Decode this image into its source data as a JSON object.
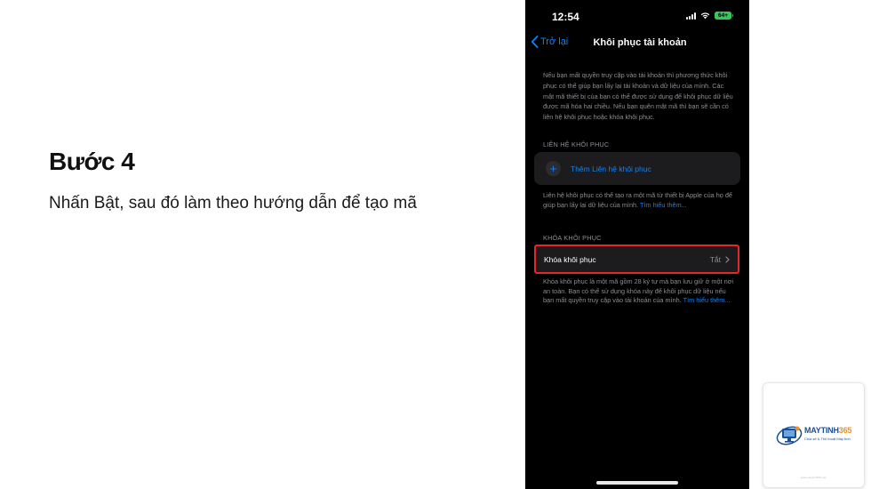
{
  "slide": {
    "title": "Bước 4",
    "description": "Nhấn Bật, sau đó làm theo hướng dẫn để tạo mã"
  },
  "status_bar": {
    "time": "12:54",
    "battery": "64+"
  },
  "nav": {
    "back_label": "Trở lại",
    "title": "Khôi phục tài khoản"
  },
  "intro_text": "Nếu bạn mất quyền truy cập vào tài khoản thì phương thức khôi phục có thể giúp bạn lấy lại tài khoản và dữ liệu của mình. Các mật mã thiết bị của bạn có thể được sử dụng để khôi phục dữ liệu được mã hóa hai chiều. Nếu bạn quên mật mã thì bạn sẽ cần có liên hệ khôi phục hoặc khóa khôi phục.",
  "recovery_contact": {
    "header": "LIÊN HỆ KHÔI PHỤC",
    "add_label": "Thêm Liên hệ khôi phục",
    "footer": "Liên hệ khôi phục có thể tạo ra một mã từ thiết bị Apple của họ để giúp bạn lấy lại dữ liệu của mình.",
    "footer_link": "Tìm hiểu thêm..."
  },
  "recovery_key": {
    "header": "KHÓA KHÔI PHỤC",
    "label": "Khóa khôi phục",
    "value": "Tắt",
    "footer": "Khóa khôi phục là một mã gồm 28 ký tự mà bạn lưu giữ ở một nơi an toàn. Bạn có thể sử dụng khóa này để khôi phục dữ liệu nếu bạn mất quyền truy cập vào tài khoản của mình.",
    "footer_link": "Tìm hiểu thêm..."
  },
  "logo": {
    "brand_part1": "MAYTINH",
    "brand_part2": "365",
    "tagline": "Chia sẻ & Thủ thuật Máy tính",
    "url": "www.maytinh365.com"
  },
  "colors": {
    "ios_blue": "#0a84ff",
    "highlight_red": "#e5262a",
    "battery_green": "#34c759",
    "brand_blue": "#1d4f91",
    "brand_orange": "#f28c1e"
  }
}
